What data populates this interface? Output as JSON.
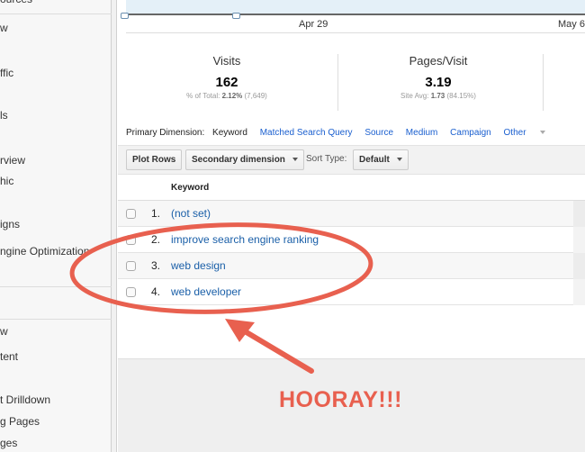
{
  "sidebar": {
    "items": [
      "ources",
      "w",
      "ffic",
      "ls",
      "rview",
      "hic",
      "igns",
      "ngine Optimization",
      "w",
      "tent",
      "t Drilldown",
      "g Pages",
      "ges"
    ]
  },
  "chart": {
    "dates": [
      "Apr 29",
      "May 6"
    ]
  },
  "stats": [
    {
      "title": "Visits",
      "value": "162",
      "sub_label": "% of Total:",
      "sub_value": "2.12%",
      "sub_extra": "(7,649)"
    },
    {
      "title": "Pages/Visit",
      "value": "3.19",
      "sub_label": "Site Avg:",
      "sub_value": "1.73",
      "sub_extra": "(84.15%)"
    }
  ],
  "dimensions": {
    "label": "Primary Dimension:",
    "active": "Keyword",
    "links": [
      "Matched Search Query",
      "Source",
      "Medium",
      "Campaign",
      "Other"
    ]
  },
  "toolbar": {
    "plot_rows": "Plot Rows",
    "secondary": "Secondary dimension",
    "sort_label": "Sort Type:",
    "sort_value": "Default"
  },
  "table": {
    "header": "Keyword",
    "rows": [
      {
        "num": "1.",
        "keyword": "(not set)"
      },
      {
        "num": "2.",
        "keyword": "improve search engine ranking"
      },
      {
        "num": "3.",
        "keyword": "web design"
      },
      {
        "num": "4.",
        "keyword": "web developer"
      }
    ]
  },
  "annotation": {
    "text": "HOORAY!!!",
    "color": "#e8604f"
  }
}
